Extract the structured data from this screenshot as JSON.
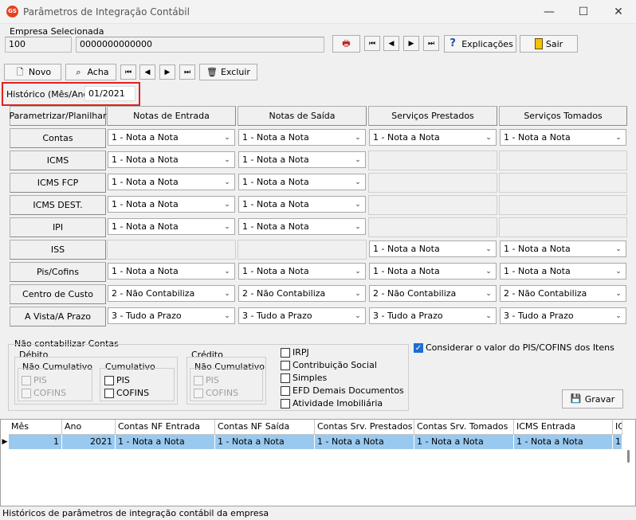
{
  "window": {
    "title": "Parâmetros de Integração Contábil",
    "icon_text": "GS",
    "minimize": "—",
    "maximize": "☐",
    "close": "✕"
  },
  "empresa": {
    "label": "Empresa Selecionada",
    "code": "100",
    "cnpj": "0000000000000"
  },
  "top_buttons": {
    "explicacoes": "Explicações",
    "sair": "Sair"
  },
  "toolbar": {
    "novo": "Novo",
    "acha": "Acha",
    "excluir": "Excluir"
  },
  "historico": {
    "label": "Histórico (Mês/Ano)",
    "value": "01/2021"
  },
  "matrix": {
    "corner": "Parametrizar/Planilhar",
    "columns": [
      "Notas de Entrada",
      "Notas de Saída",
      "Serviços Prestados",
      "Serviços Tomados"
    ],
    "rows": [
      {
        "label": "Contas",
        "values": [
          "1 - Nota a Nota",
          "1 - Nota a Nota",
          "1 - Nota a Nota",
          "1 - Nota a Nota"
        ]
      },
      {
        "label": "ICMS",
        "values": [
          "1 - Nota a Nota",
          "1 - Nota a Nota",
          null,
          null
        ]
      },
      {
        "label": "ICMS FCP",
        "values": [
          "1 - Nota a Nota",
          "1 - Nota a Nota",
          null,
          null
        ]
      },
      {
        "label": "ICMS DEST.",
        "values": [
          "1 - Nota a Nota",
          "1 - Nota a Nota",
          null,
          null
        ]
      },
      {
        "label": "IPI",
        "values": [
          "1 - Nota a Nota",
          "1 - Nota a Nota",
          null,
          null
        ]
      },
      {
        "label": "ISS",
        "values": [
          null,
          null,
          "1 - Nota a Nota",
          "1 - Nota a Nota"
        ]
      },
      {
        "label": "Pis/Cofins",
        "values": [
          "1 - Nota a Nota",
          "1 - Nota a Nota",
          "1 - Nota a Nota",
          "1 - Nota a Nota"
        ]
      },
      {
        "label": "Centro de Custo",
        "values": [
          "2 - Não Contabiliza",
          "2 - Não Contabiliza",
          "2 - Não Contabiliza",
          "2 - Não Contabiliza"
        ]
      },
      {
        "label": "A Vista/A Prazo",
        "values": [
          "3 - Tudo a Prazo",
          "3 - Tudo a Prazo",
          "3 - Tudo a Prazo",
          "3 - Tudo a Prazo"
        ]
      }
    ]
  },
  "nao_contabilizar": {
    "title": "Não contabilizar Contas",
    "debito": "Débito",
    "credito": "Crédito",
    "nao_cumulativo": "Não Cumulativo",
    "cumulativo": "Cumulativo",
    "pis": "PIS",
    "cofins": "COFINS",
    "others": [
      "IRPJ",
      "Contribuição Social",
      "Simples",
      "EFD Demais Documentos",
      "Atividade Imobiliária"
    ]
  },
  "considerar": {
    "label": "Considerar o valor do PIS/COFINS dos Itens",
    "checked": true
  },
  "gravar": "Gravar",
  "grid": {
    "headers": [
      "Mês",
      "Ano",
      "Contas NF Entrada",
      "Contas NF Saída",
      "Contas Srv. Prestados",
      "Contas Srv. Tomados",
      "ICMS Entrada",
      "IC"
    ],
    "row": [
      "1",
      "2021",
      "1 - Nota a Nota",
      "1 - Nota a Nota",
      "1 - Nota a Nota",
      "1 - Nota a Nota",
      "1 - Nota a Nota",
      "1"
    ]
  },
  "status": "Históricos de parâmetros de integração contábil da empresa",
  "colors": {
    "highlight": "#e02020",
    "selected_row": "#99c9ef",
    "checkbox_on": "#1f6dd4"
  }
}
